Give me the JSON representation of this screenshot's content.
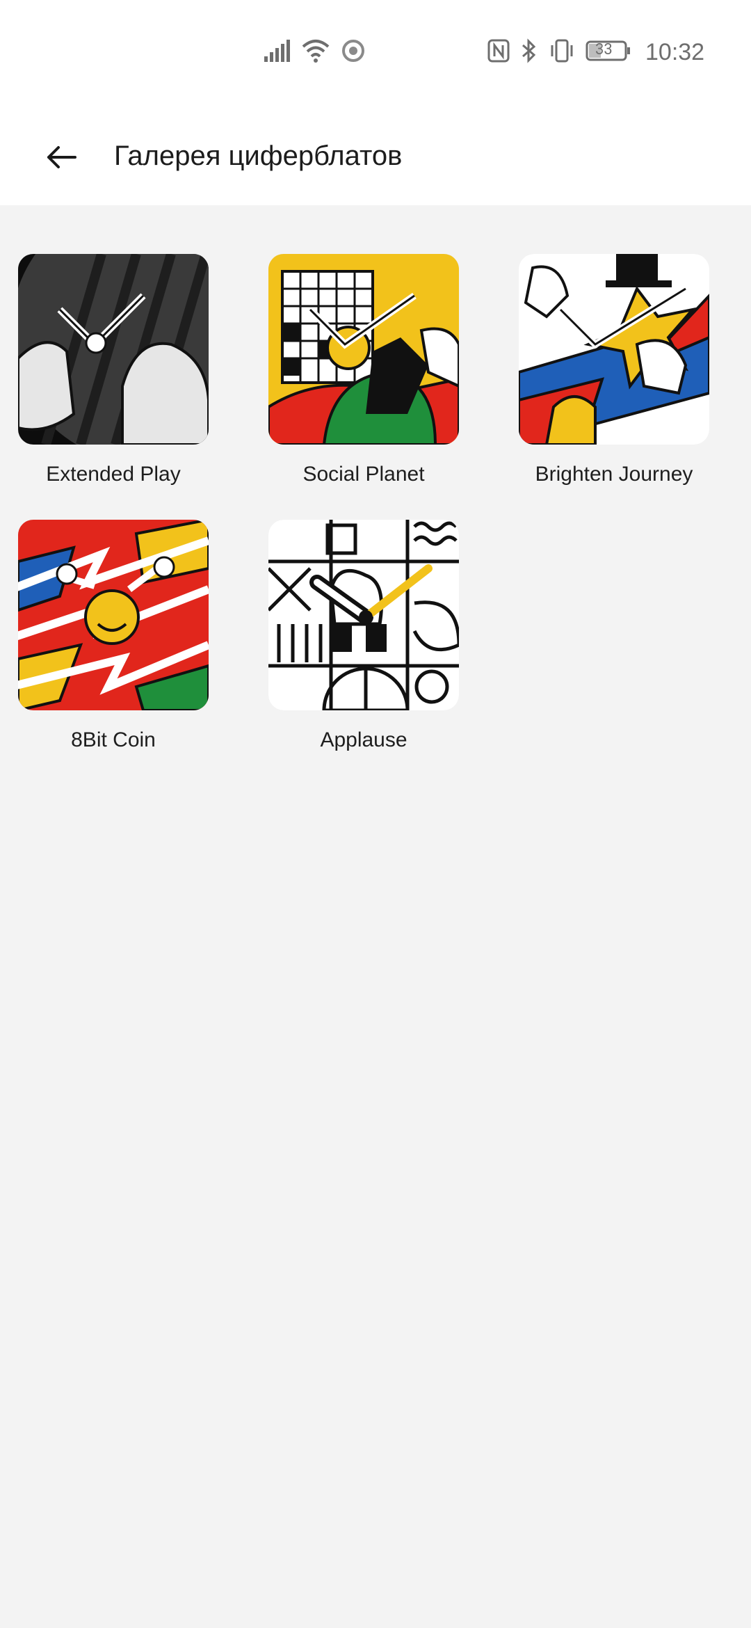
{
  "status_bar": {
    "time": "10:32",
    "battery_level": "33",
    "icons": [
      "signal-icon",
      "wifi-icon",
      "sync-icon",
      "nfc-icon",
      "bluetooth-icon",
      "vibrate-icon",
      "battery-icon"
    ]
  },
  "header": {
    "back_icon": "arrow-left-icon",
    "title": "Галерея циферблатов"
  },
  "gallery": {
    "items": [
      {
        "label": "Extended Play",
        "theme": "gray-monochrome"
      },
      {
        "label": "Social Planet",
        "theme": "yellow-red-green"
      },
      {
        "label": "Brighten Journey",
        "theme": "yellow-blue-red"
      },
      {
        "label": "8Bit Coin",
        "theme": "red-yellow-blue-green"
      },
      {
        "label": "Applause",
        "theme": "black-white-yellow"
      }
    ]
  },
  "colors": {
    "background": "#f3f3f3",
    "surface": "#ffffff",
    "text": "#1a1a1a",
    "status_icons": "#6e6e6e"
  }
}
